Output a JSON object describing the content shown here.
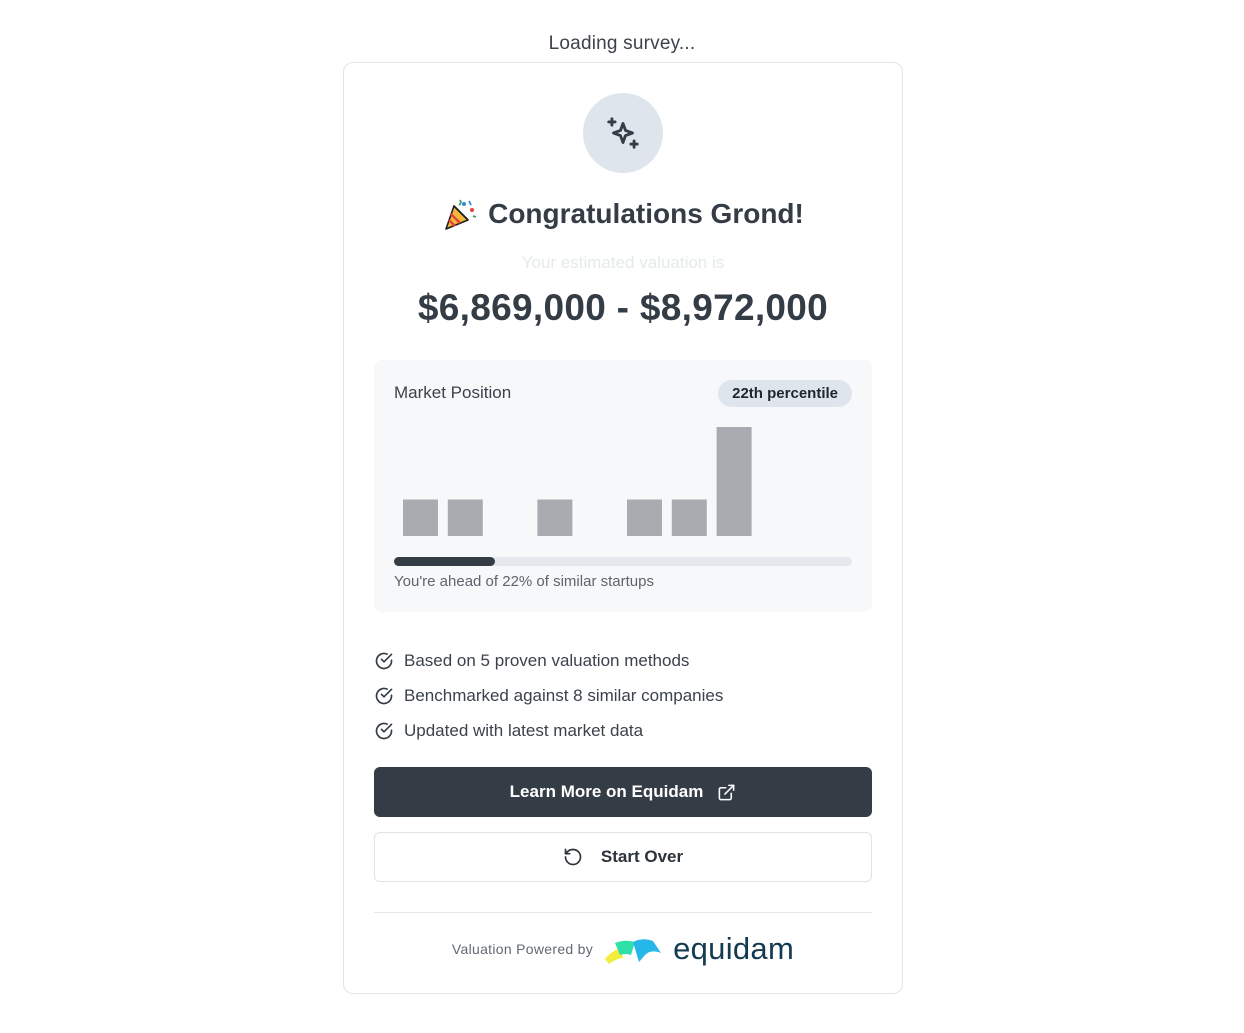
{
  "status": {
    "loading_text": "Loading survey..."
  },
  "header": {
    "icon": "sparkles-icon",
    "emoji": "party-popper-icon",
    "title": "Congratulations Grond!",
    "subtitle": "Your estimated valuation is",
    "valuation_range": "$6,869,000 - $8,972,000"
  },
  "market_position": {
    "label": "Market Position",
    "badge": "22th percentile",
    "percentile": 22,
    "summary": "You're ahead of 22% of similar startups"
  },
  "chart_data": {
    "type": "bar",
    "values": [
      1,
      1,
      0,
      1,
      0,
      1,
      1,
      2
    ],
    "highlight_index": 2,
    "colors": {
      "default": "#a8acb1",
      "highlight": "#343c46"
    },
    "title": "",
    "xlabel": "",
    "ylabel": ""
  },
  "features": [
    {
      "icon": "check-circle-icon",
      "text": "Based on 5 proven valuation methods"
    },
    {
      "icon": "check-circle-icon",
      "text": "Benchmarked against 8 similar companies"
    },
    {
      "icon": "check-circle-icon",
      "text": "Updated with latest market data"
    }
  ],
  "actions": {
    "learn_more": {
      "label": "Learn More on Equidam",
      "icon": "external-link-icon"
    },
    "start_over": {
      "label": "Start Over",
      "icon": "rotate-ccw-icon"
    }
  },
  "footer": {
    "powered_by": "Valuation Powered by",
    "brand": "equidam",
    "logo": "equidam-logo"
  },
  "colors": {
    "primary": "#343c46",
    "badge_bg": "#dfe5ec",
    "panel_bg": "#f7f8fa",
    "bar_default": "#a8acb1"
  }
}
